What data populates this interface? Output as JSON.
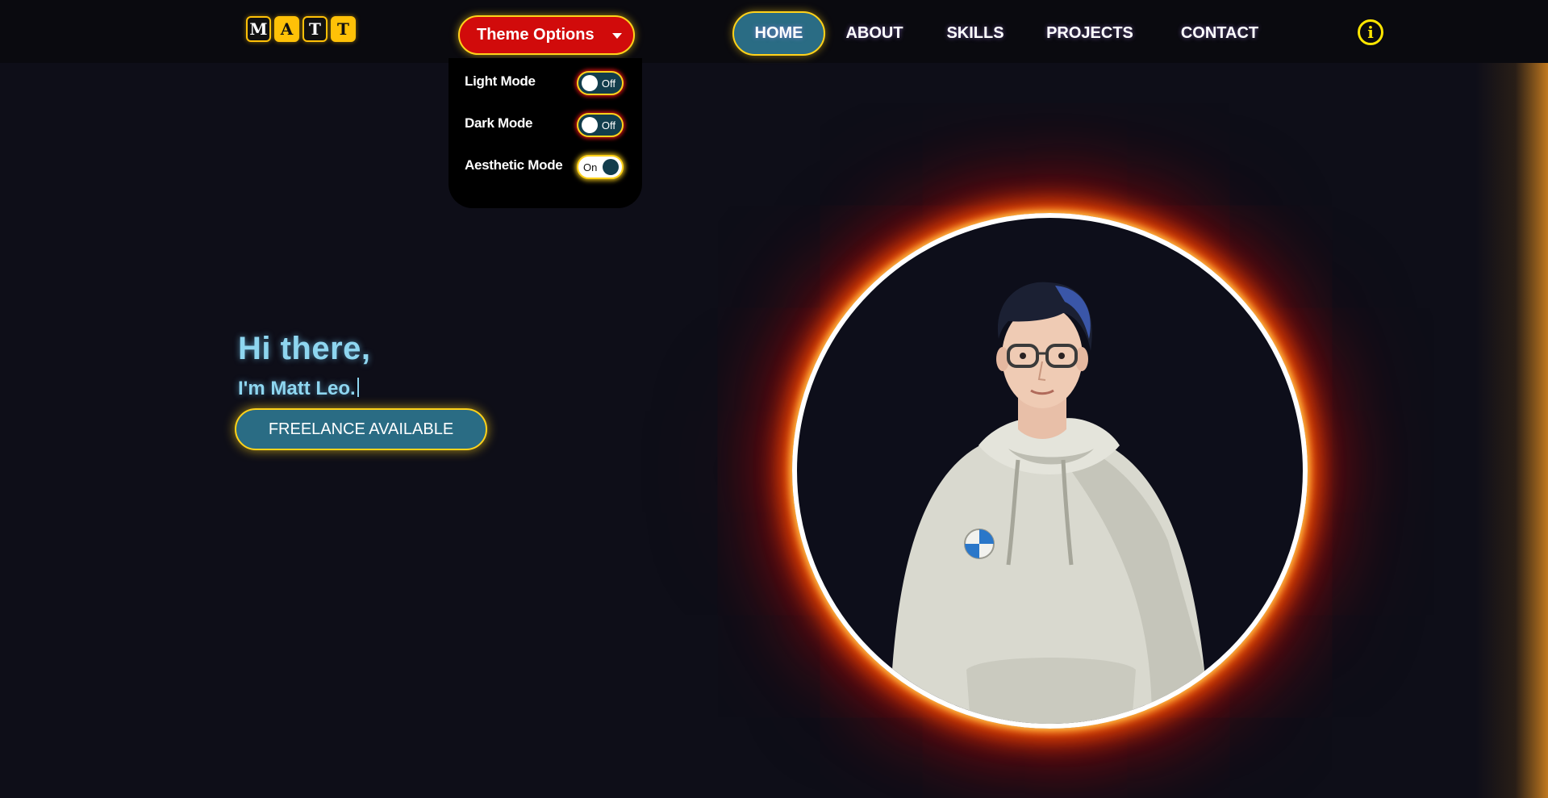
{
  "logo": {
    "letters": [
      "M",
      "A",
      "T",
      "T"
    ]
  },
  "theme_menu": {
    "button_label": "Theme Options",
    "options": [
      {
        "label": "Light Mode",
        "state": "Off"
      },
      {
        "label": "Dark Mode",
        "state": "Off"
      },
      {
        "label": "Aesthetic Mode",
        "state": "On"
      }
    ]
  },
  "nav": {
    "items": [
      {
        "label": "HOME",
        "active": true
      },
      {
        "label": "ABOUT",
        "active": false
      },
      {
        "label": "SKILLS",
        "active": false
      },
      {
        "label": "PROJECTS",
        "active": false
      },
      {
        "label": "CONTACT",
        "active": false
      }
    ],
    "info_icon": "info-icon"
  },
  "hero": {
    "greeting": "Hi there,",
    "name_line": "I'm Matt Leo.",
    "cta_label": "FREELANCE AVAILABLE"
  },
  "colors": {
    "background": "#0e0e18",
    "accent_yellow": "#ffd21a",
    "brand_red": "#d10b0b",
    "teal": "#2a6c84",
    "hero_text": "#8ed6f0"
  }
}
